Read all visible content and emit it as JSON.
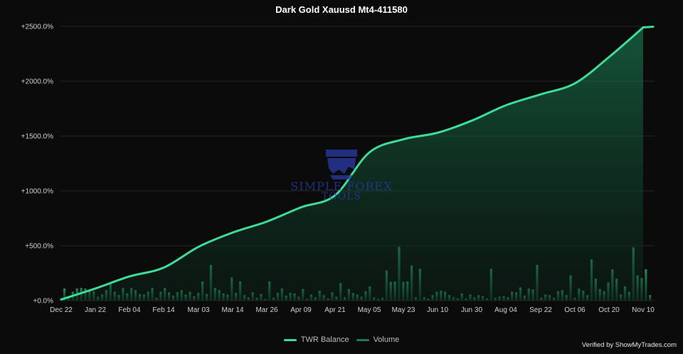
{
  "chart_data": {
    "type": "area",
    "title": "Dark Gold Xauusd Mt4-411580",
    "y_ticks": [
      "+0.0%",
      "+500.0%",
      "+1000.0%",
      "+1500.0%",
      "+2000.0%",
      "+2500.0%"
    ],
    "ylim": [
      0,
      2500
    ],
    "x_ticks": [
      "Dec 22",
      "Jan 22",
      "Feb 04",
      "Feb 14",
      "Mar 03",
      "Mar 14",
      "Mar 26",
      "Apr 09",
      "Apr 21",
      "May 05",
      "May 23",
      "Jun 10",
      "Jun 30",
      "Aug 04",
      "Sep 22",
      "Oct 06",
      "Oct 20",
      "Nov 10"
    ],
    "grid": true,
    "legend_position": "bottom",
    "series": [
      {
        "name": "TWR Balance",
        "color": "#3ddc97",
        "x": [
          "Dec 22",
          "Jan 22",
          "Feb 04",
          "Feb 14",
          "Mar 03",
          "Mar 14",
          "Mar 26",
          "Apr 09",
          "Apr 21",
          "May 05",
          "May 23",
          "Jun 10",
          "Jun 30",
          "Aug 04",
          "Sep 22",
          "Oct 06",
          "Oct 20",
          "Nov 10"
        ],
        "values": [
          10,
          110,
          220,
          300,
          490,
          620,
          720,
          850,
          960,
          1350,
          1470,
          1530,
          1640,
          1780,
          1880,
          1980,
          2220,
          2490
        ]
      },
      {
        "name": "Volume",
        "color": "#1f7a52",
        "values": [
          0.22,
          0.06,
          0.16,
          0.22,
          0.23,
          0.22,
          0.18,
          0.17,
          0.07,
          0.11,
          0.19,
          0.31,
          0.16,
          0.1,
          0.23,
          0.13,
          0.23,
          0.19,
          0.12,
          0.11,
          0.16,
          0.23,
          0.05,
          0.16,
          0.23,
          0.15,
          0.09,
          0.15,
          0.19,
          0.11,
          0.16,
          0.08,
          0.14,
          0.35,
          0.12,
          0.65,
          0.23,
          0.19,
          0.13,
          0.11,
          0.42,
          0.14,
          0.35,
          0.1,
          0.06,
          0.15,
          0.05,
          0.12,
          0.03,
          0.35,
          0.05,
          0.14,
          0.22,
          0.09,
          0.14,
          0.13,
          0.07,
          0.21,
          0.03,
          0.11,
          0.06,
          0.18,
          0.1,
          0.04,
          0.15,
          0.07,
          0.32,
          0.06,
          0.21,
          0.14,
          0.11,
          0.07,
          0.17,
          0.26,
          0.06,
          0.03,
          0.05,
          0.55,
          0.34,
          0.35,
          0.98,
          0.34,
          0.35,
          0.64,
          0.06,
          0.58,
          0.06,
          0.04,
          0.1,
          0.16,
          0.18,
          0.16,
          0.1,
          0.06,
          0.04,
          0.13,
          0.04,
          0.11,
          0.06,
          0.1,
          0.08,
          0.04,
          0.58,
          0.05,
          0.07,
          0.08,
          0.06,
          0.16,
          0.15,
          0.24,
          0.09,
          0.22,
          0.2,
          0.65,
          0.05,
          0.11,
          0.1,
          0.05,
          0.17,
          0.19,
          0.1,
          0.46,
          0.05,
          0.22,
          0.18,
          0.1,
          0.75,
          0.4,
          0.21,
          0.17,
          0.33,
          0.57,
          0.4,
          0.11,
          0.26,
          0.16,
          0.97,
          0.46,
          0.41,
          0.57,
          0.1
        ]
      }
    ]
  },
  "legend": {
    "item1": "TWR Balance",
    "item2": "Volume"
  },
  "watermark": {
    "line1": "SIMPLE FOREX",
    "line2": "TOOLS"
  },
  "footer": "Verified by ShowMyTrades.com"
}
